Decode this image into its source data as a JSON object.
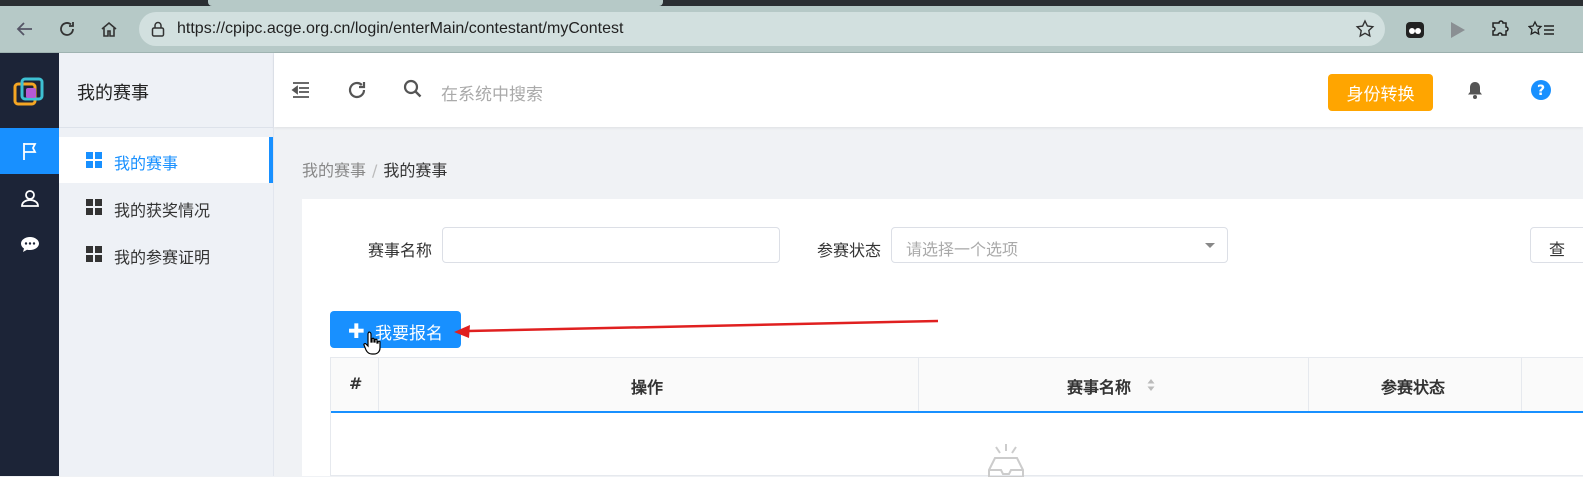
{
  "browser": {
    "url": "https://cpipc.acge.org.cn/login/enterMain/contestant/myContest"
  },
  "sidebar": {
    "title": "我的赛事",
    "items": [
      {
        "label": "我的赛事",
        "active": true
      },
      {
        "label": "我的获奖情况",
        "active": false
      },
      {
        "label": "我的参赛证明",
        "active": false
      }
    ]
  },
  "header": {
    "search_placeholder": "在系统中搜索",
    "switch_button": "身份转换"
  },
  "breadcrumb": {
    "parent": "我的赛事",
    "separator": "/",
    "current": "我的赛事"
  },
  "filters": {
    "contest_name_label": "赛事名称",
    "contest_name_value": "",
    "status_label": "参赛状态",
    "status_placeholder": "请选择一个选项",
    "query_button": "查"
  },
  "actions": {
    "register_button": "我要报名"
  },
  "table": {
    "columns": [
      "#",
      "操作",
      "赛事名称",
      "参赛状态"
    ]
  },
  "colors": {
    "accent": "#1890ff",
    "switch_button": "#ffa500",
    "rail": "#1c2437",
    "annotation_arrow": "#e02020"
  }
}
